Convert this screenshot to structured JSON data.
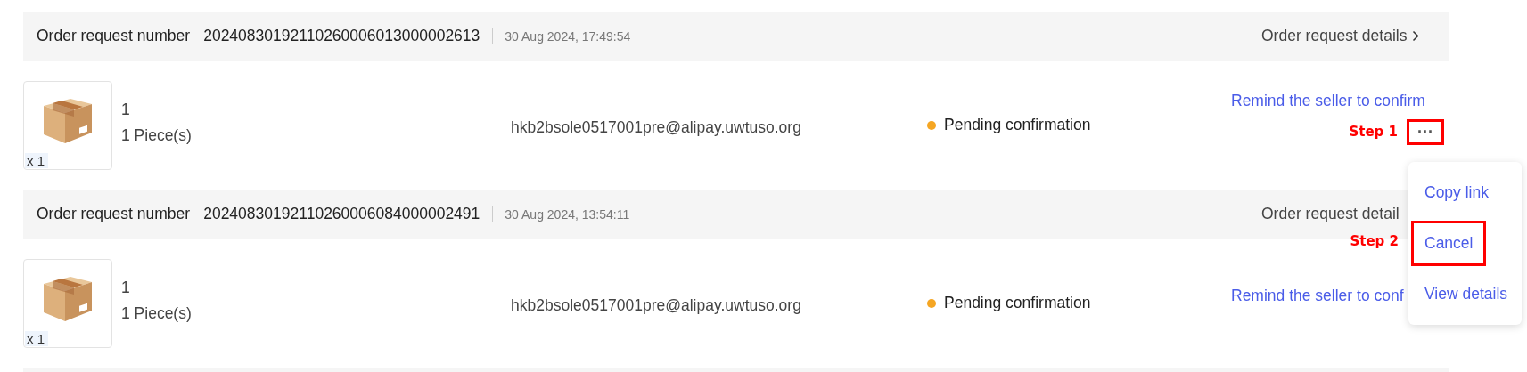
{
  "orders": [
    {
      "label": "Order request number",
      "number": "20240830192110260006013000002613",
      "date": "30 Aug 2024, 17:49:54",
      "details_link": "Order request details",
      "details_chevron": true,
      "product": {
        "quantity_badge": "x 1",
        "line_1": "1",
        "line_2": "1 Piece(s)"
      },
      "seller": "hkb2bsole0517001pre@alipay.uwtuso.org",
      "status": {
        "text": "Pending confirmation",
        "color": "#f5a623"
      },
      "action_link": "Remind the seller to confirm",
      "more_button": {
        "label": "···",
        "annotation": "Step 1",
        "highlighted": true
      }
    },
    {
      "label": "Order request number",
      "number": "20240830192110260006084000002491",
      "date": "30 Aug 2024, 13:54:11",
      "details_link": "Order request detail",
      "details_chevron": false,
      "product": {
        "quantity_badge": "x 1",
        "line_1": "1",
        "line_2": "1 Piece(s)"
      },
      "seller": "hkb2bsole0517001pre@alipay.uwtuso.org",
      "status": {
        "text": "Pending confirmation",
        "color": "#f5a623"
      },
      "action_link": "Remind the seller to conf"
    }
  ],
  "menu": {
    "items": [
      {
        "label": "Copy link",
        "highlighted": false
      },
      {
        "label": "Cancel",
        "highlighted": true,
        "annotation": "Step 2"
      },
      {
        "label": "View details",
        "highlighted": false
      }
    ]
  }
}
